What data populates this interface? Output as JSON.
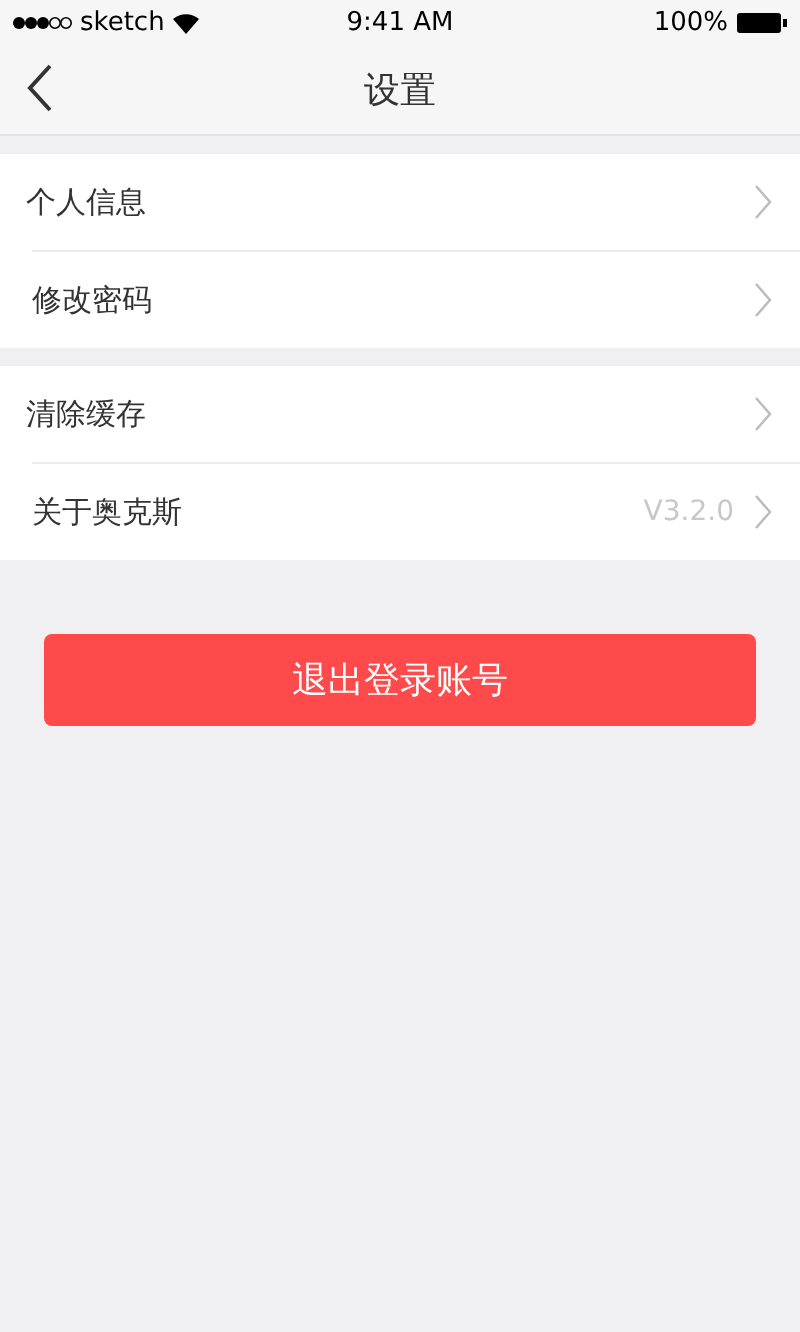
{
  "status_bar": {
    "carrier": "sketch",
    "time": "9:41 AM",
    "battery": "100%"
  },
  "nav": {
    "title": "设置"
  },
  "groups": [
    [
      {
        "label": "个人信息"
      },
      {
        "label": "修改密码"
      }
    ],
    [
      {
        "label": "清除缓存"
      },
      {
        "label": "关于奥克斯",
        "value": "V3.2.0"
      }
    ]
  ],
  "logout_button": "退出登录账号"
}
